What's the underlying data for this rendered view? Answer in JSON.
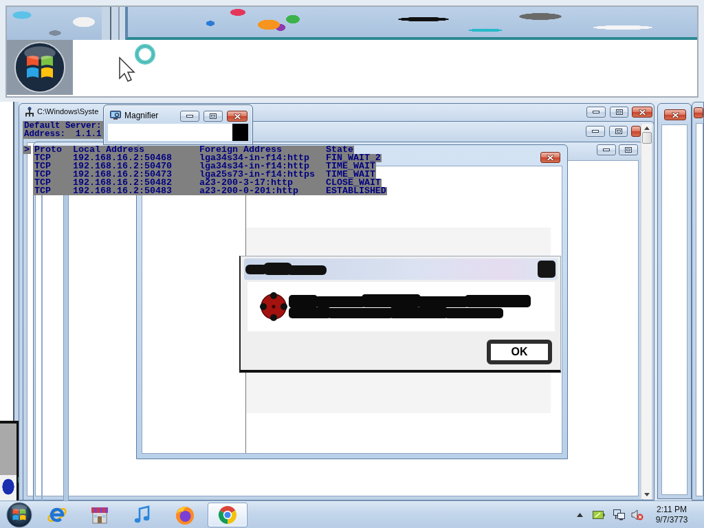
{
  "console_window": {
    "title": "C:\\Windows\\Syste",
    "lines": [
      "Default Server:",
      "Address:  1.1.1"
    ]
  },
  "netstat": {
    "marker": ">",
    "columns": [
      "Proto",
      "Local Address",
      "Foreign Address",
      "State"
    ],
    "rows": [
      [
        "TCP",
        "192.168.16.2:50468",
        "lga34s34-in-f14:http",
        "FIN_WAIT_2"
      ],
      [
        "TCP",
        "192.168.16.2:50470",
        "lga34s34-in-f14:http",
        "TIME_WAIT"
      ],
      [
        "TCP",
        "192.168.16.2:50473",
        "lga25s73-in-f14:https",
        "TIME_WAIT"
      ],
      [
        "TCP",
        "192.168.16.2:50482",
        "a23-200-3-17:http",
        "CLOSE_WAIT"
      ],
      [
        "TCP",
        "192.168.16.2:50483",
        "a23-200-0-201:http",
        "ESTABLISHED"
      ]
    ]
  },
  "magnifier": {
    "title": "Magnifier"
  },
  "error_dialog": {
    "button": "OK"
  },
  "taskbar": {
    "apps": [
      {
        "kind": "e-logo",
        "selected": false
      },
      {
        "kind": "shop",
        "selected": false
      },
      {
        "kind": "music",
        "selected": false
      },
      {
        "kind": "fox",
        "selected": false
      },
      {
        "kind": "ring",
        "selected": true
      }
    ],
    "clock": {
      "time": "2:11 PM",
      "date": "9/7/3773"
    }
  }
}
